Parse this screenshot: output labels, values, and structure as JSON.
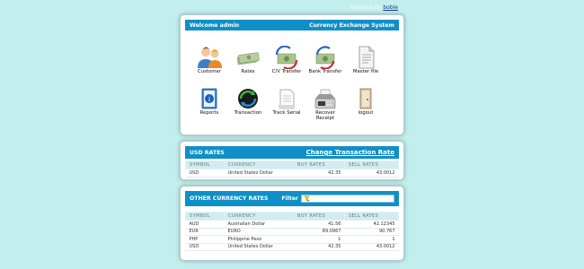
{
  "powered": {
    "prefix": "Powered By",
    "link": "bobie"
  },
  "header": {
    "welcome": "Welcome admin",
    "system": "Currency Exchange System"
  },
  "menu": [
    {
      "label": "Customer",
      "icon": "customer-icon"
    },
    {
      "label": "Rates",
      "icon": "money-icon"
    },
    {
      "label": "C/V Transfer",
      "icon": "cv-transfer-icon"
    },
    {
      "label": "Bank Transfer",
      "icon": "bank-transfer-icon"
    },
    {
      "label": "Master file",
      "icon": "master-file-icon"
    },
    {
      "label": "Reports",
      "icon": "reports-icon"
    },
    {
      "label": "Transaction",
      "icon": "transaction-icon"
    },
    {
      "label": "Track Serial",
      "icon": "track-serial-icon"
    },
    {
      "label": "Recover Receipt",
      "icon": "cash-register-icon"
    },
    {
      "label": "logout",
      "icon": "logout-icon"
    }
  ],
  "usd_rates": {
    "title": "USD RATES",
    "action": "Change Transaction Rate",
    "columns": [
      "SYMBOL",
      "CURRENCY",
      "BUY RATES",
      "SELL RATES"
    ],
    "rows": [
      [
        "USD",
        "United States Dollar",
        "42.35",
        "43.0012"
      ]
    ]
  },
  "other_rates": {
    "title": "OTHER CURRENCY RATES",
    "filter_label": "Filter",
    "filter_value": "",
    "columns": [
      "SYMBOL",
      "CURRENCY",
      "BUY RATES",
      "SELL RATES"
    ],
    "rows": [
      [
        "AUD",
        "Australian Dollar",
        "41.56",
        "42.12345"
      ],
      [
        "EUR",
        "EURO",
        "89.0967",
        "90.767"
      ],
      [
        "PHP",
        "Philippine Peso",
        "1",
        "1"
      ],
      [
        "USD",
        "United States Dollar",
        "42.35",
        "43.0012"
      ]
    ]
  },
  "colors": {
    "background": "#c3eeee",
    "header": "#0f8fc8",
    "table_header": "#d2ecef"
  }
}
